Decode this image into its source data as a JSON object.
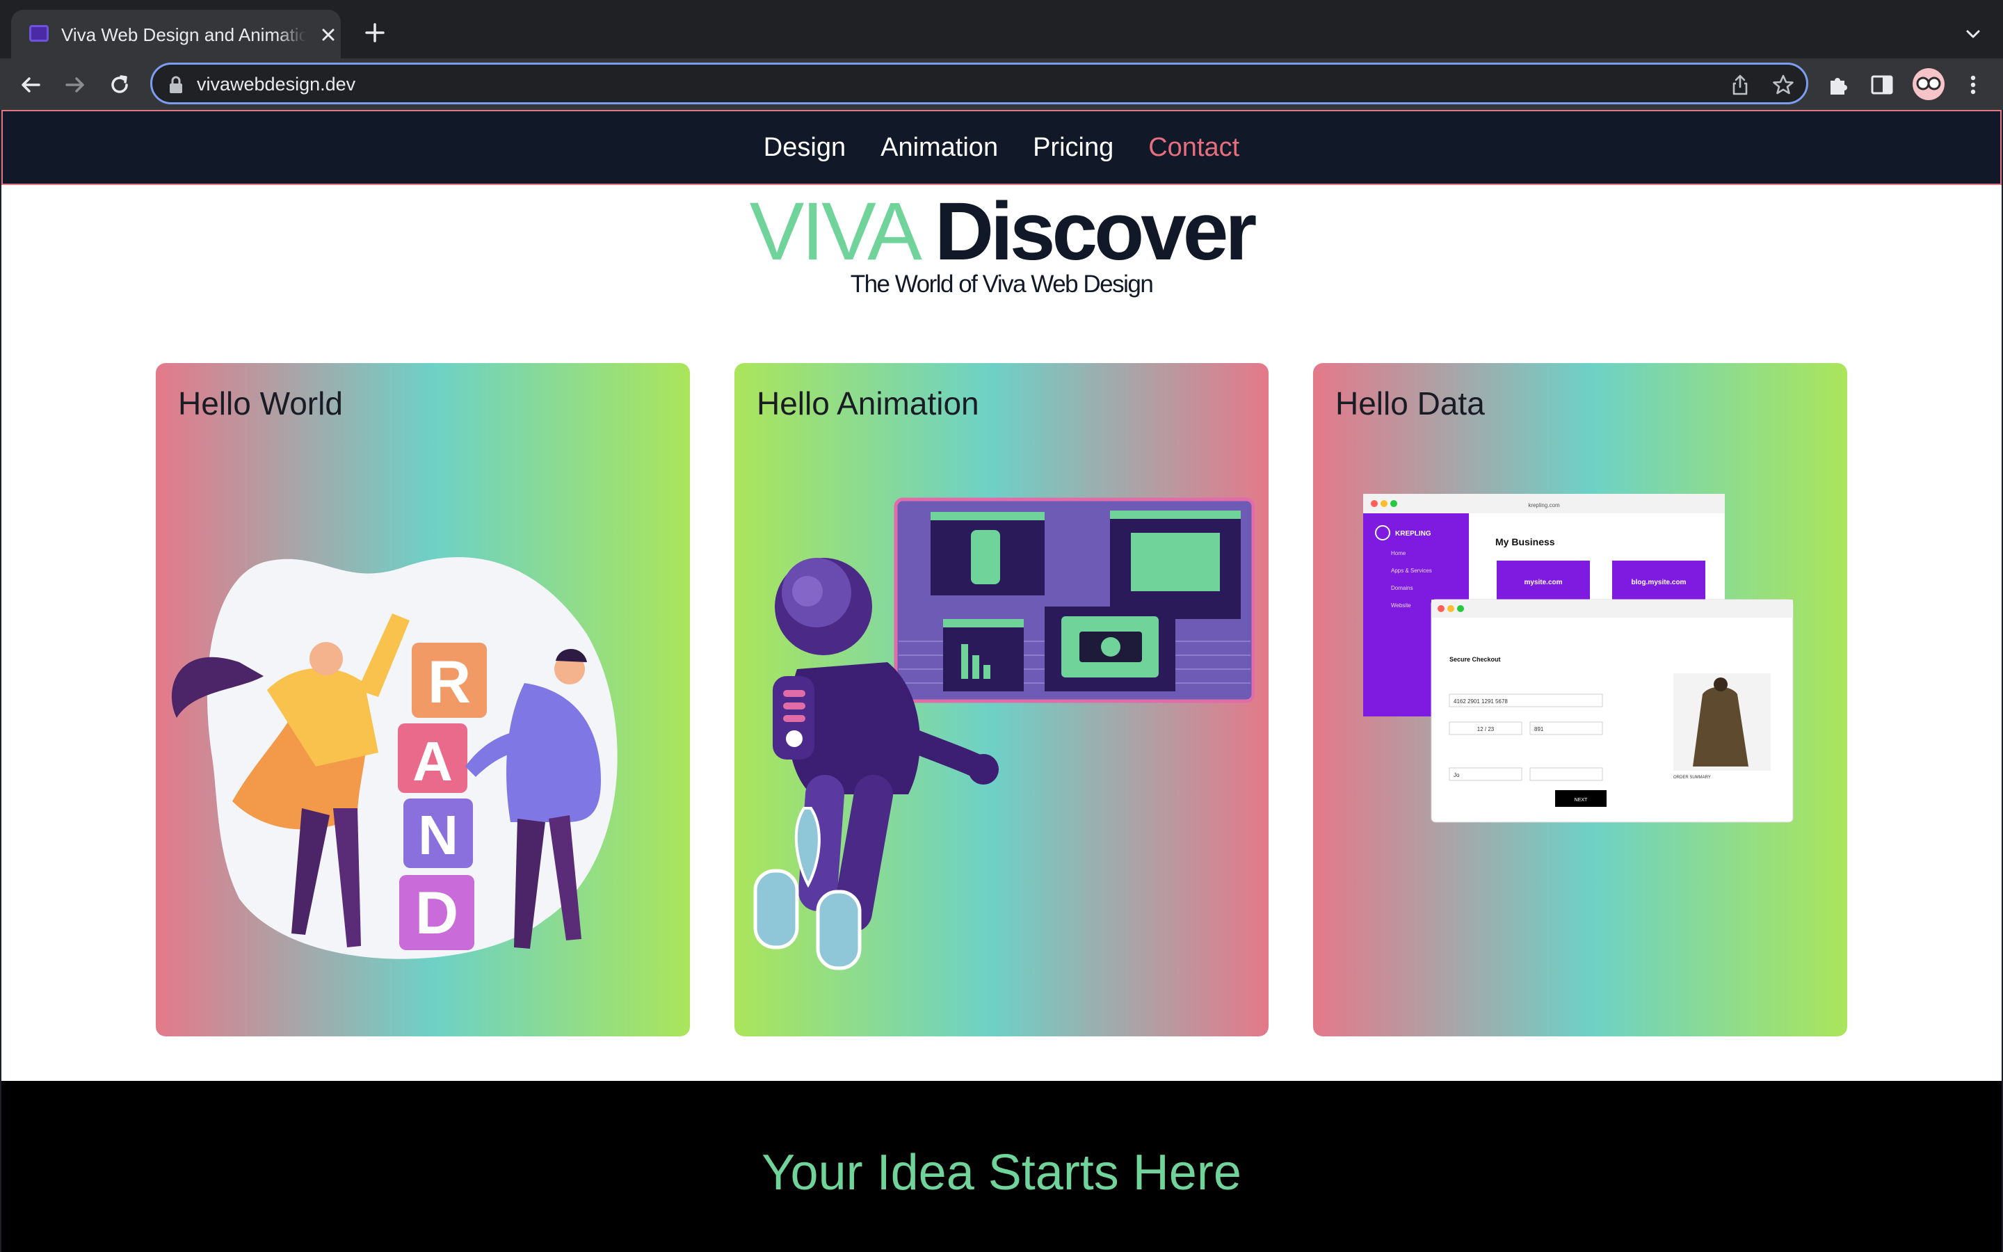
{
  "browser": {
    "tab_title": "Viva Web Design and Animation",
    "url": "vivawebdesign.dev"
  },
  "nav": {
    "links": [
      {
        "label": "Design"
      },
      {
        "label": "Animation"
      },
      {
        "label": "Pricing"
      },
      {
        "label": "Contact"
      }
    ],
    "active": "Contact"
  },
  "hero": {
    "title_light": "VIVA",
    "title_bold": "Discover",
    "subtitle": "The World of Viva Web Design"
  },
  "cards": [
    {
      "title": "Hello World",
      "illustration": "people-stacking-brand-blocks",
      "blocks": [
        "R",
        "A",
        "N",
        "D"
      ]
    },
    {
      "title": "Hello Animation",
      "illustration": "astronaut-with-screens"
    },
    {
      "title": "Hello Data",
      "illustration": "dashboard-checkout-mockup",
      "mockup": {
        "domain": "krepling.com",
        "brand": "KREPLING",
        "heading": "My Business",
        "menu": [
          "Home",
          "Apps & Services",
          "Domains",
          "Website"
        ],
        "sites": [
          "mysite.com",
          "blog.mysite.com"
        ],
        "checkout_title": "Secure Checkout",
        "fields": {
          "card": "4162 2901 1291 5678",
          "expiration": "12 / 23",
          "cvv": "891",
          "first_name": "Jo"
        },
        "next_button": "NEXT",
        "order_summary": "ORDER SUMMARY"
      }
    }
  ],
  "footer": {
    "tagline": "Your Idea Starts Here"
  },
  "colors": {
    "accent_green": "#6fd39a",
    "accent_pink": "#e56f7e",
    "nav_bg": "#111827",
    "footer_bg": "#000000"
  }
}
